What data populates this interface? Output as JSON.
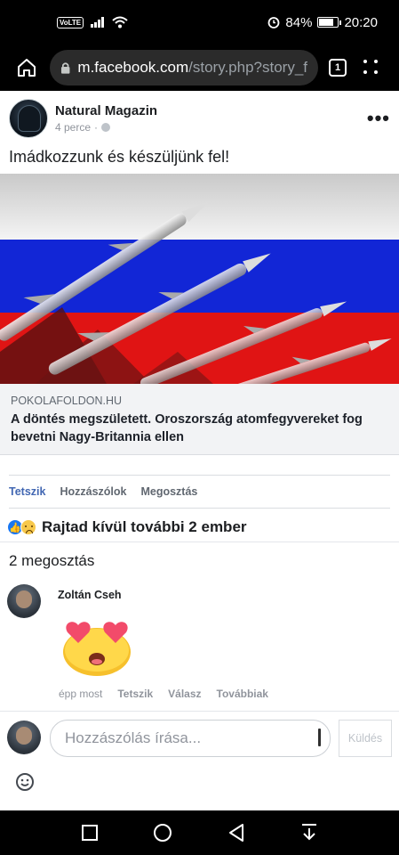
{
  "status_bar": {
    "volte": "VoLTE",
    "battery_percent": "84%",
    "battery_level": 0.84,
    "time": "20:20"
  },
  "browser": {
    "url_host": "m.facebook.com",
    "url_path": "/story.php?story_f",
    "tab_count": "1"
  },
  "post": {
    "page_name": "Natural Magazin",
    "time": "4 perce",
    "separator": "·",
    "text": "Imádkozzunk és készüljünk fel!",
    "link": {
      "domain": "POKOLAFOLDON.HU",
      "title": "A döntés megszületett. Oroszország atomfegyvereket fog bevetni Nagy-Britannia ellen"
    },
    "actions": {
      "like": "Tetszik",
      "comments": "Hozzászólok",
      "share": "Megosztás"
    },
    "reactions_text": "Rajtad kívül további 2 ember",
    "shares_text": "2 megosztás"
  },
  "comment": {
    "author": "Zoltán Cseh",
    "time": "épp most",
    "like": "Tetszik",
    "reply": "Válasz",
    "more": "Továbbiak"
  },
  "composer": {
    "placeholder": "Hozzászólás írása...",
    "send": "Küldés"
  },
  "colors": {
    "accent": "#4267b2",
    "muted": "#90949c"
  }
}
